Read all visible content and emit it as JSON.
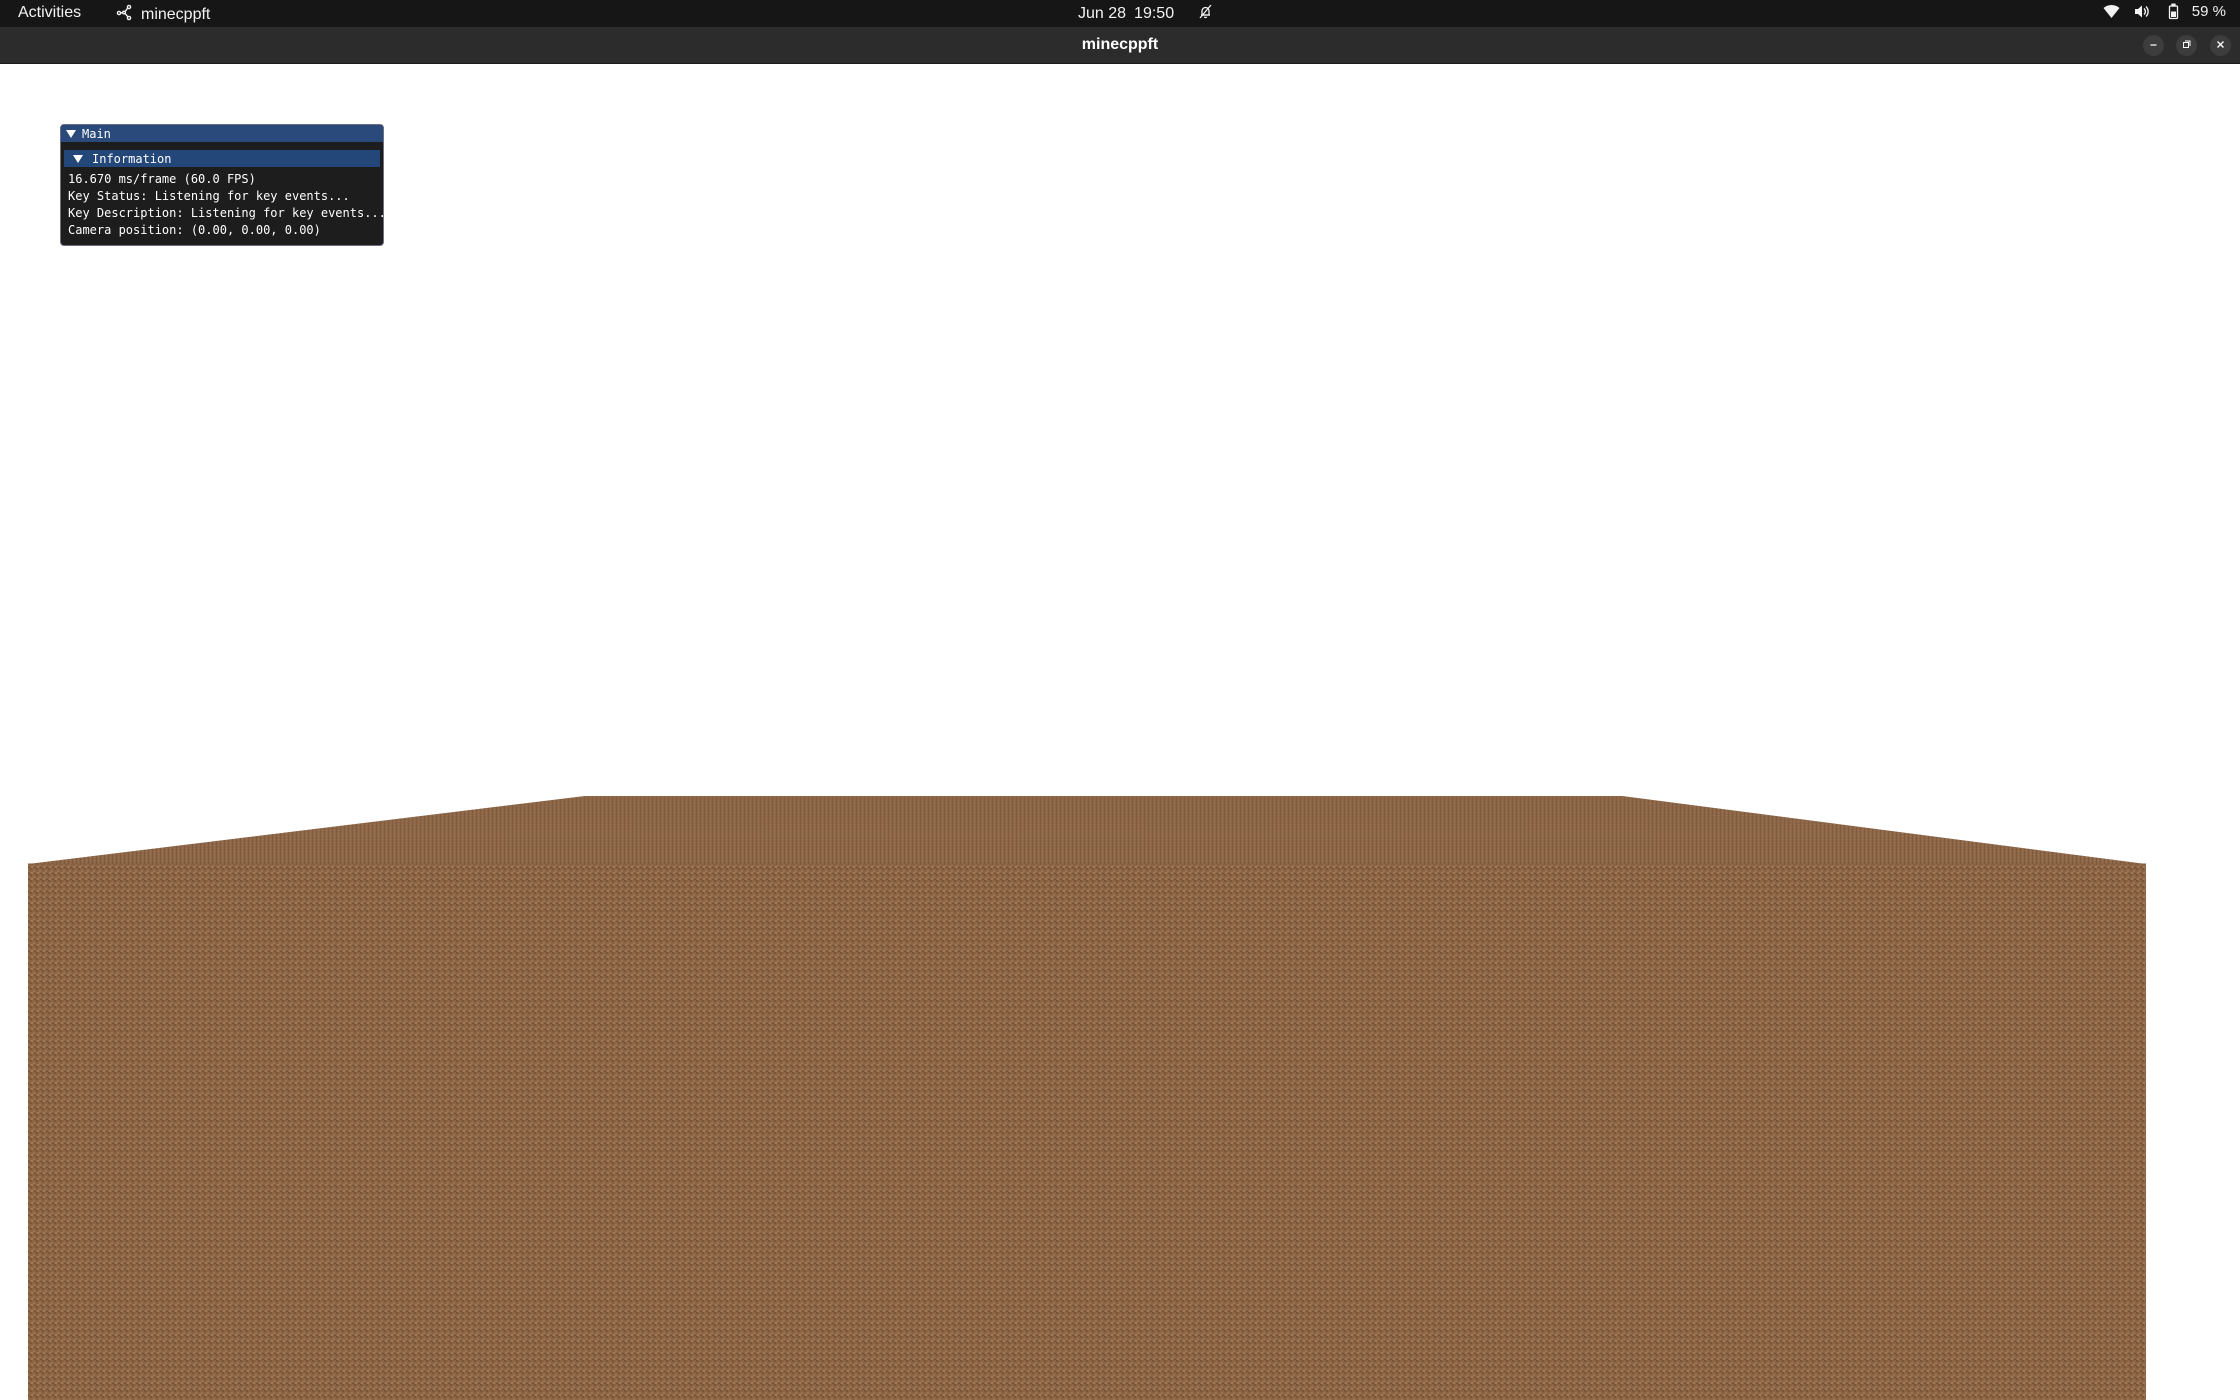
{
  "topbar": {
    "activities": "Activities",
    "app_name": "minecppft",
    "app_icon": "app-graph-icon",
    "date": "Jun 28",
    "time": "19:50",
    "notification_icon": "bell-muted-icon",
    "wifi_icon": "wifi-icon",
    "volume_icon": "volume-icon",
    "battery_icon": "battery-icon",
    "battery_percent": "59 %"
  },
  "window": {
    "title": "minecppft",
    "controls": [
      "minimize",
      "restore",
      "close"
    ]
  },
  "imgui": {
    "window_title": "Main",
    "section_title": "Information",
    "lines": [
      "16.670 ms/frame (60.0 FPS)",
      "Key Status: Listening for key events...",
      "Key Description: Listening for key events...",
      "Camera position: (0.00, 0.00, 0.00)"
    ]
  },
  "scene": {
    "sky_color": "#ffffff",
    "ground_color": "#8b6444",
    "ground_top_color": "#8e6748"
  },
  "colors": {
    "topbar_bg": "#161616",
    "titlebar_bg": "#2c2c2c",
    "imgui_title_bg": "#294a7a",
    "imgui_header_bg": "#24477a"
  }
}
